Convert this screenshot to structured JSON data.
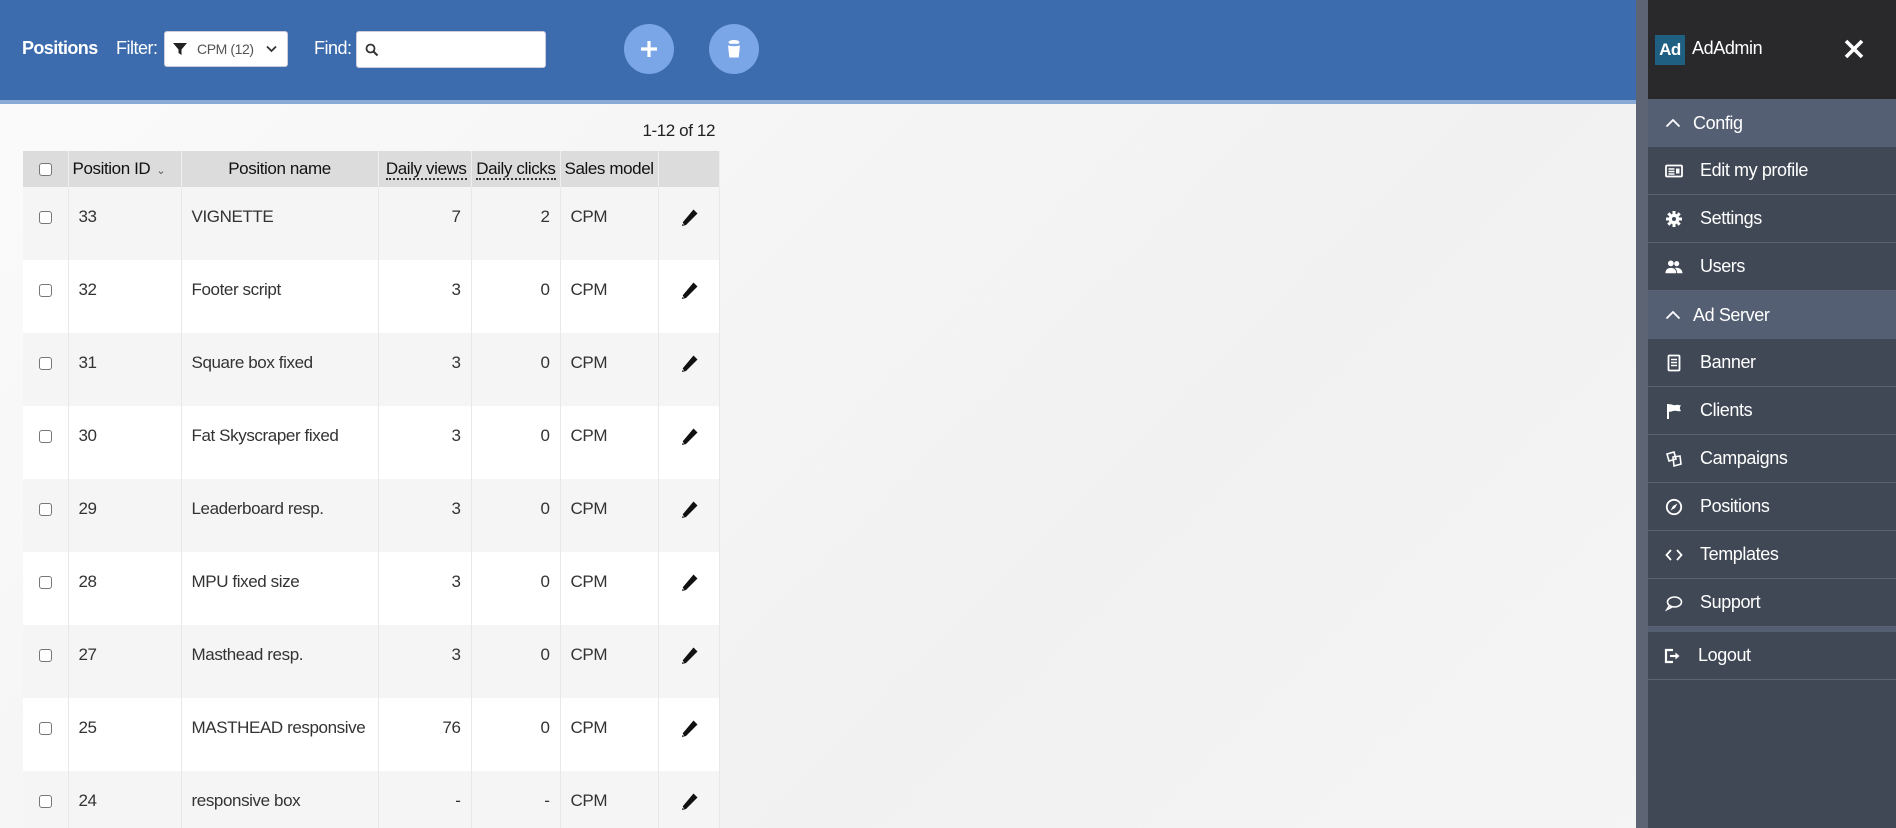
{
  "header": {
    "title": "Positions",
    "filter_label": "Filter:",
    "filter_value": "CPM (12)",
    "find_label": "Find:",
    "find_value": "",
    "find_placeholder": "",
    "add_button": "add",
    "delete_button": "delete"
  },
  "pager": "1-12 of 12",
  "table": {
    "columns": {
      "id": "Position ID",
      "name": "Position name",
      "views": "Daily views",
      "clicks": "Daily clicks",
      "model": "Sales model"
    },
    "rows": [
      {
        "id": "33",
        "name": "VIGNETTE",
        "views": "7",
        "clicks": "2",
        "model": "CPM"
      },
      {
        "id": "32",
        "name": "Footer script",
        "views": "3",
        "clicks": "0",
        "model": "CPM"
      },
      {
        "id": "31",
        "name": "Square box fixed",
        "views": "3",
        "clicks": "0",
        "model": "CPM"
      },
      {
        "id": "30",
        "name": "Fat Skyscraper fixed",
        "views": "3",
        "clicks": "0",
        "model": "CPM"
      },
      {
        "id": "29",
        "name": "Leaderboard resp.",
        "views": "3",
        "clicks": "0",
        "model": "CPM"
      },
      {
        "id": "28",
        "name": "MPU fixed size",
        "views": "3",
        "clicks": "0",
        "model": "CPM"
      },
      {
        "id": "27",
        "name": "Masthead resp.",
        "views": "3",
        "clicks": "0",
        "model": "CPM"
      },
      {
        "id": "25",
        "name": "MASTHEAD responsive",
        "views": "76",
        "clicks": "0",
        "model": "CPM"
      },
      {
        "id": "24",
        "name": "responsive box",
        "views": "-",
        "clicks": "-",
        "model": "CPM"
      }
    ]
  },
  "sidebar": {
    "logo": "Ad",
    "brand": "AdAdmin",
    "sections": [
      {
        "label": "Config",
        "items": [
          {
            "label": "Edit my profile",
            "icon": "profile-card-icon"
          },
          {
            "label": "Settings",
            "icon": "gear-icon"
          },
          {
            "label": "Users",
            "icon": "users-icon"
          }
        ]
      },
      {
        "label": "Ad Server",
        "items": [
          {
            "label": "Banner",
            "icon": "document-icon"
          },
          {
            "label": "Clients",
            "icon": "flag-icon"
          },
          {
            "label": "Campaigns",
            "icon": "campaigns-icon"
          },
          {
            "label": "Positions",
            "icon": "compass-icon"
          },
          {
            "label": "Templates",
            "icon": "code-icon"
          },
          {
            "label": "Support",
            "icon": "chat-bubble-icon"
          }
        ]
      }
    ],
    "logout": "Logout"
  },
  "colors": {
    "header_blue": "#3c6cad",
    "button_blue": "#7aa5e6",
    "sidebar_bg": "#404856",
    "sidebar_section": "#545f73",
    "sidebar_head": "#29292b",
    "logo_bg": "#1f5f82"
  }
}
